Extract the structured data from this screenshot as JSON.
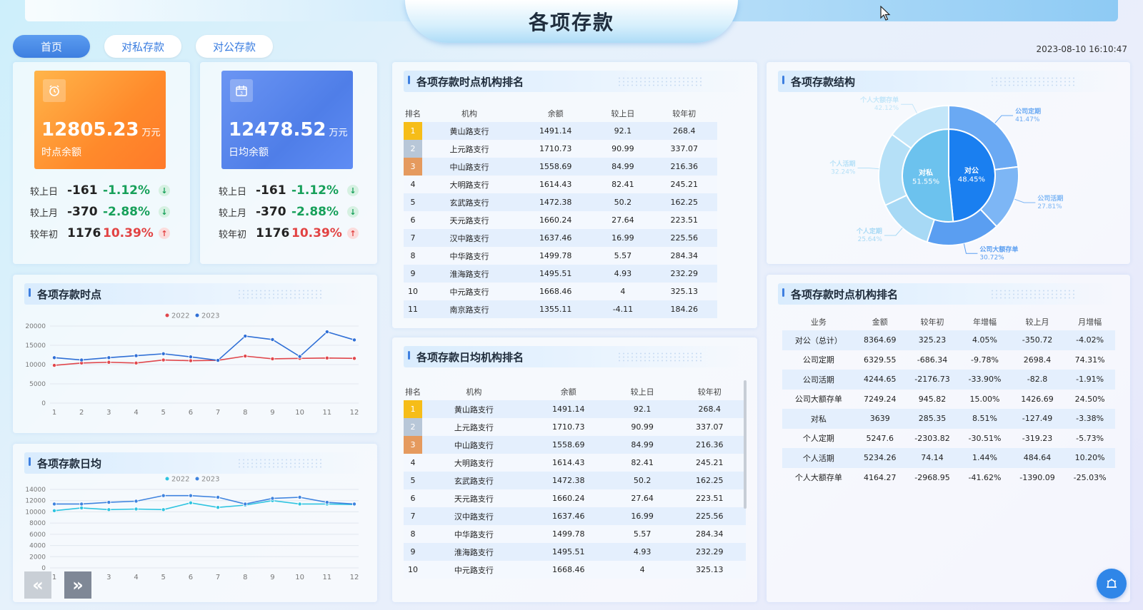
{
  "header": {
    "title": "各项存款",
    "datetime": "2023-08-10 16:10:47"
  },
  "tabs": [
    {
      "label": "首页",
      "active": true
    },
    {
      "label": "对私存款",
      "active": false
    },
    {
      "label": "对公存款",
      "active": false
    }
  ],
  "kpi": [
    {
      "value": "12805.23",
      "unit": "万元",
      "label": "时点余额",
      "color": "#ff8a2b",
      "icon": "alarm-clock-icon",
      "rows": [
        {
          "label": "较上日",
          "num": "-161",
          "pct": "-1.12%",
          "dir": "down"
        },
        {
          "label": "较上月",
          "num": "-370",
          "pct": "-2.88%",
          "dir": "down"
        },
        {
          "label": "较年初",
          "num": "1176",
          "pct": "10.39%",
          "dir": "up"
        }
      ]
    },
    {
      "value": "12478.52",
      "unit": "万元",
      "label": "日均余额",
      "color": "#5f8cf4",
      "icon": "calendar-icon",
      "rows": [
        {
          "label": "较上日",
          "num": "-161",
          "pct": "-1.12%",
          "dir": "down"
        },
        {
          "label": "较上月",
          "num": "-370",
          "pct": "-2.88%",
          "dir": "down"
        },
        {
          "label": "较年初",
          "num": "1176",
          "pct": "10.39%",
          "dir": "up"
        }
      ]
    }
  ],
  "point_rank": {
    "title": "各项存款时点机构排名",
    "headers": [
      "排名",
      "机构",
      "余额",
      "较上日",
      "较年初"
    ],
    "rows": [
      [
        "1",
        "黄山路支行",
        "1491.14",
        "92.1",
        "268.4"
      ],
      [
        "2",
        "上元路支行",
        "1710.73",
        "90.99",
        "337.07"
      ],
      [
        "3",
        "中山路支行",
        "1558.69",
        "84.99",
        "216.36"
      ],
      [
        "4",
        "大明路支行",
        "1614.43",
        "82.41",
        "245.21"
      ],
      [
        "5",
        "玄武路支行",
        "1472.38",
        "50.2",
        "162.25"
      ],
      [
        "6",
        "天元路支行",
        "1660.24",
        "27.64",
        "223.51"
      ],
      [
        "7",
        "汉中路支行",
        "1637.46",
        "16.99",
        "225.56"
      ],
      [
        "8",
        "中华路支行",
        "1499.78",
        "5.57",
        "284.34"
      ],
      [
        "9",
        "淮海路支行",
        "1495.51",
        "4.93",
        "232.29"
      ],
      [
        "10",
        "中元路支行",
        "1668.46",
        "4",
        "325.13"
      ],
      [
        "11",
        "南京路支行",
        "1355.11",
        "-4.11",
        "184.26"
      ]
    ]
  },
  "avg_rank": {
    "title": "各项存款日均机构排名",
    "headers": [
      "排名",
      "机构",
      "余额",
      "较上日",
      "较年初"
    ],
    "rows": [
      [
        "1",
        "黄山路支行",
        "1491.14",
        "92.1",
        "268.4"
      ],
      [
        "2",
        "上元路支行",
        "1710.73",
        "90.99",
        "337.07"
      ],
      [
        "3",
        "中山路支行",
        "1558.69",
        "84.99",
        "216.36"
      ],
      [
        "4",
        "大明路支行",
        "1614.43",
        "82.41",
        "245.21"
      ],
      [
        "5",
        "玄武路支行",
        "1472.38",
        "50.2",
        "162.25"
      ],
      [
        "6",
        "天元路支行",
        "1660.24",
        "27.64",
        "223.51"
      ],
      [
        "7",
        "汉中路支行",
        "1637.46",
        "16.99",
        "225.56"
      ],
      [
        "8",
        "中华路支行",
        "1499.78",
        "5.57",
        "284.34"
      ],
      [
        "9",
        "淮海路支行",
        "1495.51",
        "4.93",
        "232.29"
      ],
      [
        "10",
        "中元路支行",
        "1668.46",
        "4",
        "325.13"
      ]
    ]
  },
  "structure": {
    "title": "各项存款结构",
    "inner": [
      {
        "name": "对私",
        "pct": "51.55%",
        "value": 51.55,
        "color": "#6cc2ee"
      },
      {
        "name": "对公",
        "pct": "48.45%",
        "value": 48.45,
        "color": "#1a7ff0"
      }
    ],
    "outer": [
      {
        "name": "公司定期",
        "pct": "41.47%",
        "value": 23.0,
        "color": "#6aa9f3"
      },
      {
        "name": "公司活期",
        "pct": "27.81%",
        "value": 15.0,
        "color": "#7db6f5"
      },
      {
        "name": "公司大额存单",
        "pct": "30.72%",
        "value": 17.0,
        "color": "#5a9ef1"
      },
      {
        "name": "个人定期",
        "pct": "25.64%",
        "value": 13.0,
        "color": "#a7d9f5"
      },
      {
        "name": "个人活期",
        "pct": "32.24%",
        "value": 17.0,
        "color": "#b5e0f7"
      },
      {
        "name": "个人大额存单",
        "pct": "42.12%",
        "value": 15.0,
        "color": "#c3e6f9"
      }
    ]
  },
  "point_table": {
    "title": "各项存款时点机构排名",
    "headers": [
      "业务",
      "金额",
      "较年初",
      "年增幅",
      "较上月",
      "月增幅"
    ],
    "rows": [
      [
        "对公（总计）",
        "8364.69",
        "325.23",
        "4.05%",
        "-350.72",
        "-4.02%"
      ],
      [
        "公司定期",
        "6329.55",
        "-686.34",
        "-9.78%",
        "2698.4",
        "74.31%"
      ],
      [
        "公司活期",
        "4244.65",
        "-2176.73",
        "-33.90%",
        "-82.8",
        "-1.91%"
      ],
      [
        "公司大额存单",
        "7249.24",
        "945.82",
        "15.00%",
        "1426.69",
        "24.50%"
      ],
      [
        "对私",
        "3639",
        "285.35",
        "8.51%",
        "-127.49",
        "-3.38%"
      ],
      [
        "个人定期",
        "5247.6",
        "-2303.82",
        "-30.51%",
        "-319.23",
        "-5.73%"
      ],
      [
        "个人活期",
        "5234.26",
        "74.14",
        "1.44%",
        "484.64",
        "10.20%"
      ],
      [
        "个人大额存单",
        "4164.27",
        "-2968.95",
        "-41.62%",
        "-1390.09",
        "-25.03%"
      ]
    ]
  },
  "chart_data": [
    {
      "type": "line",
      "title": "各项存款时点",
      "x": [
        1,
        2,
        3,
        4,
        5,
        6,
        7,
        8,
        9,
        10,
        11,
        12
      ],
      "ylim": [
        0,
        20000
      ],
      "yticks": [
        0,
        5000,
        10000,
        15000,
        20000
      ],
      "legend_position": "top-center",
      "series": [
        {
          "name": "2022",
          "color": "#e0474c",
          "values": [
            9800,
            10400,
            10600,
            10400,
            11200,
            11000,
            11100,
            12200,
            11500,
            11600,
            11700,
            11600
          ]
        },
        {
          "name": "2023",
          "color": "#2f6fd6",
          "values": [
            11800,
            11200,
            11800,
            12300,
            12800,
            12000,
            11100,
            17400,
            16500,
            12100,
            18500,
            16400
          ]
        }
      ]
    },
    {
      "type": "line",
      "title": "各项存款日均",
      "x": [
        1,
        2,
        3,
        4,
        5,
        6,
        7,
        8,
        9,
        10,
        11,
        12
      ],
      "ylim": [
        0,
        14000
      ],
      "yticks": [
        0,
        2000,
        4000,
        6000,
        8000,
        10000,
        12000,
        14000
      ],
      "legend_position": "top-center",
      "series": [
        {
          "name": "2022",
          "color": "#2ec4e0",
          "values": [
            10200,
            10700,
            10400,
            10500,
            10400,
            11600,
            10800,
            11200,
            12000,
            11400,
            11400,
            11300
          ]
        },
        {
          "name": "2023",
          "color": "#3e83df",
          "values": [
            11400,
            11400,
            11700,
            11900,
            12900,
            12900,
            12600,
            11400,
            12400,
            12600,
            11700,
            11400
          ]
        }
      ]
    }
  ],
  "nav": {
    "prev": "«",
    "next": "»"
  }
}
